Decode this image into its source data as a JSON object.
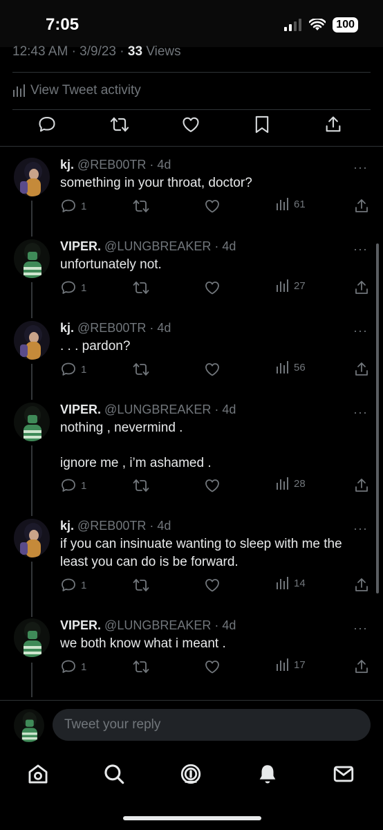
{
  "status_bar": {
    "time": "7:05",
    "battery": "100"
  },
  "tweet_meta": {
    "time": "12:43 AM",
    "date": "3/9/23",
    "views_count": "33",
    "views_label": "Views",
    "sep": "·"
  },
  "activity_label": "View Tweet activity",
  "replies": [
    {
      "name": "kj.",
      "handle": "@REB00TR",
      "age": "4d",
      "text": "something in your throat, doctor?",
      "reply_count": "1",
      "views": "61",
      "avatar": "kj"
    },
    {
      "name": "VIPER.",
      "handle": "@LUNGBREAKER",
      "age": "4d",
      "text": "unfortunately not.",
      "reply_count": "1",
      "views": "27",
      "avatar": "viper"
    },
    {
      "name": "kj.",
      "handle": "@REB00TR",
      "age": "4d",
      "text": ". . . pardon?",
      "reply_count": "1",
      "views": "56",
      "avatar": "kj"
    },
    {
      "name": "VIPER.",
      "handle": "@LUNGBREAKER",
      "age": "4d",
      "text": "nothing , nevermind .",
      "text2": "ignore me , i’m ashamed .",
      "reply_count": "1",
      "views": "28",
      "avatar": "viper"
    },
    {
      "name": "kj.",
      "handle": "@REB00TR",
      "age": "4d",
      "text": "if you can insinuate wanting to sleep with me the least you can do is be forward.",
      "reply_count": "1",
      "views": "14",
      "avatar": "kj"
    },
    {
      "name": "VIPER.",
      "handle": "@LUNGBREAKER",
      "age": "4d",
      "text": "we both know what i meant .",
      "reply_count": "1",
      "views": "17",
      "avatar": "viper"
    }
  ],
  "reply_box": {
    "placeholder": "Tweet your reply"
  },
  "icons": {
    "status": [
      "signal-icon",
      "wifi-icon",
      "battery-icon"
    ],
    "tweet_actions": [
      "reply-icon",
      "retweet-icon",
      "like-icon",
      "bookmark-icon",
      "share-icon"
    ],
    "nav": [
      "home-icon",
      "search-icon",
      "spaces-icon",
      "notifications-icon",
      "messages-icon"
    ]
  },
  "colors": {
    "background": "#000000",
    "text": "#e7e9ea",
    "muted": "#71767b",
    "divider": "#2f3336",
    "kj_avatar": "#c58a3a",
    "viper_avatar": "#3f8a58"
  }
}
